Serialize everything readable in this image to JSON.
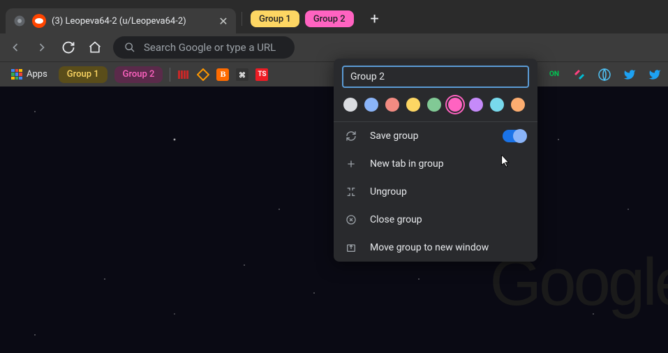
{
  "tab": {
    "title": "(3) Leopeva64-2 (u/Leopeva64-2)"
  },
  "groups": {
    "tab_group1": "Group 1",
    "tab_group2": "Group 2"
  },
  "omnibox": {
    "placeholder": "Search Google or type a URL"
  },
  "bookmarks": {
    "apps_label": "Apps",
    "group1": "Group 1",
    "group2": "Group 2"
  },
  "popup": {
    "input_value": "Group 2",
    "colors": [
      {
        "name": "grey",
        "hex": "#dadce0"
      },
      {
        "name": "blue",
        "hex": "#8ab4f8"
      },
      {
        "name": "red",
        "hex": "#f28b82"
      },
      {
        "name": "yellow",
        "hex": "#fdd663"
      },
      {
        "name": "green",
        "hex": "#81c995"
      },
      {
        "name": "pink",
        "hex": "#ff63c1",
        "selected": true
      },
      {
        "name": "purple",
        "hex": "#c58af9"
      },
      {
        "name": "cyan",
        "hex": "#78d9ec"
      },
      {
        "name": "orange",
        "hex": "#fcad70"
      }
    ],
    "save_group": "Save group",
    "save_toggle": true,
    "new_tab": "New tab in group",
    "ungroup": "Ungroup",
    "close_group": "Close group",
    "move_window": "Move group to new window"
  },
  "ghost": "Google"
}
